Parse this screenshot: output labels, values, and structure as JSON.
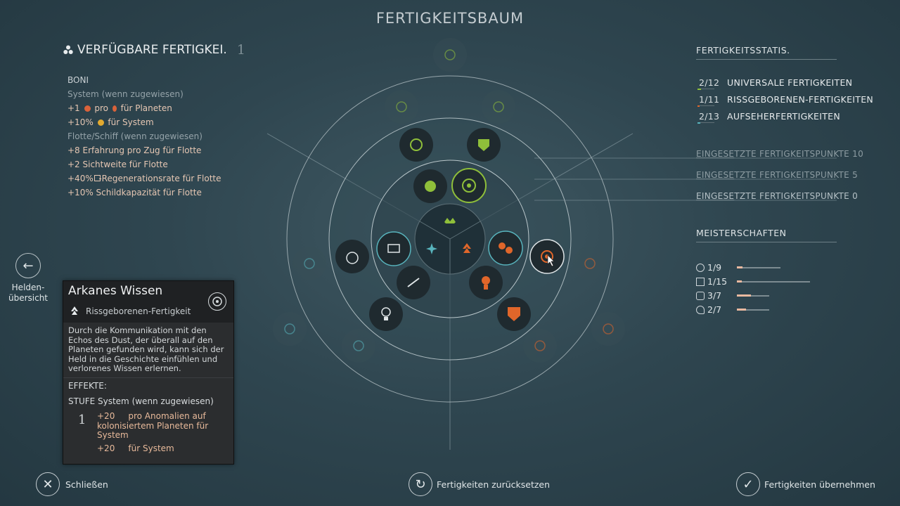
{
  "title": "FERTIGKEITSBAUM",
  "available": {
    "label": "VERFÜGBARE FERTIGKEI.",
    "count": "1",
    "icon": "skill-cluster-icon"
  },
  "boni": {
    "header": "BONI",
    "system_label": "System (wenn zugewiesen)",
    "system_items": [
      {
        "pre": "+1",
        "mid": "pro",
        "post": "für Planeten"
      },
      {
        "pre": "+10%",
        "mid": "",
        "post": "für System"
      }
    ],
    "fleet_label": "Flotte/Schiff (wenn zugewiesen)",
    "fleet_items": [
      "+8 Erfahrung pro Zug für Flotte",
      "+2 Sichtweite für Flotte",
      "+40%  -Regenerationsrate für Flotte",
      "+10% Schildkapazität für Flotte"
    ]
  },
  "hero_overview": {
    "label_line1": "Helden-",
    "label_line2": "übersicht",
    "icon": "arrow-left-icon"
  },
  "tooltip": {
    "name": "Arkanes Wissen",
    "type": "Rissgeborenen-Fertigkeit",
    "description": "Durch die Kommunikation mit den Echos des Dust, der überall auf den Planeten gefunden wird, kann sich der Held in die Geschichte einfühlen und verlorenes Wissen erlernen.",
    "effects_label": "EFFEKTE:",
    "stufe_label": "STUFE",
    "scope": "System (wenn zugewiesen)",
    "level": "1",
    "effect1": "+20     pro Anomalien auf kolonisiertem Planeten für System",
    "effect2": "+20     für System"
  },
  "stats": {
    "header": "FERTIGKEITSSTATIS.",
    "rows": [
      {
        "count": "2/12",
        "label": "UNIVERSALE FERTIGKEITEN",
        "color": "#7fb23a"
      },
      {
        "count": "1/11",
        "label": "RISSGEBORENEN-FERTIGKEITEN",
        "color": "#e0632a"
      },
      {
        "count": "2/13",
        "label": "AUFSEHERFERTIGKEITEN",
        "color": "#4aa7b0"
      }
    ]
  },
  "points": [
    {
      "pre": "EINGESE",
      "post": "TZTE FERTIGKEITSPUNKTE 10"
    },
    {
      "pre": "EINGESE",
      "post": "TZTE FERTIGKEITSPUNKTE 5"
    },
    {
      "pre": "EINGESE",
      "post": "TZTE FERTIGKEITSPUNKTE 0"
    }
  ],
  "mastery": {
    "header": "MEISTERSCHAFTEN",
    "rows": [
      {
        "value": "1/9",
        "fraction": 0.11,
        "icon": "mastery-gear-icon"
      },
      {
        "value": "1/15",
        "fraction": 0.07,
        "icon": "mastery-hammer-icon"
      },
      {
        "value": "3/7",
        "fraction": 0.43,
        "icon": "mastery-spark-icon"
      },
      {
        "value": "2/7",
        "fraction": 0.29,
        "icon": "mastery-eye-icon"
      }
    ]
  },
  "buttons": {
    "close": "Schließen",
    "reset": "Fertigkeiten zurücksetzen",
    "apply": "Fertigkeiten übernehmen"
  },
  "colors": {
    "universal": "#8fbf3a",
    "riftborn": "#e0662a",
    "overseer": "#58b4bd",
    "bonus_text": "#e6c7b3"
  }
}
